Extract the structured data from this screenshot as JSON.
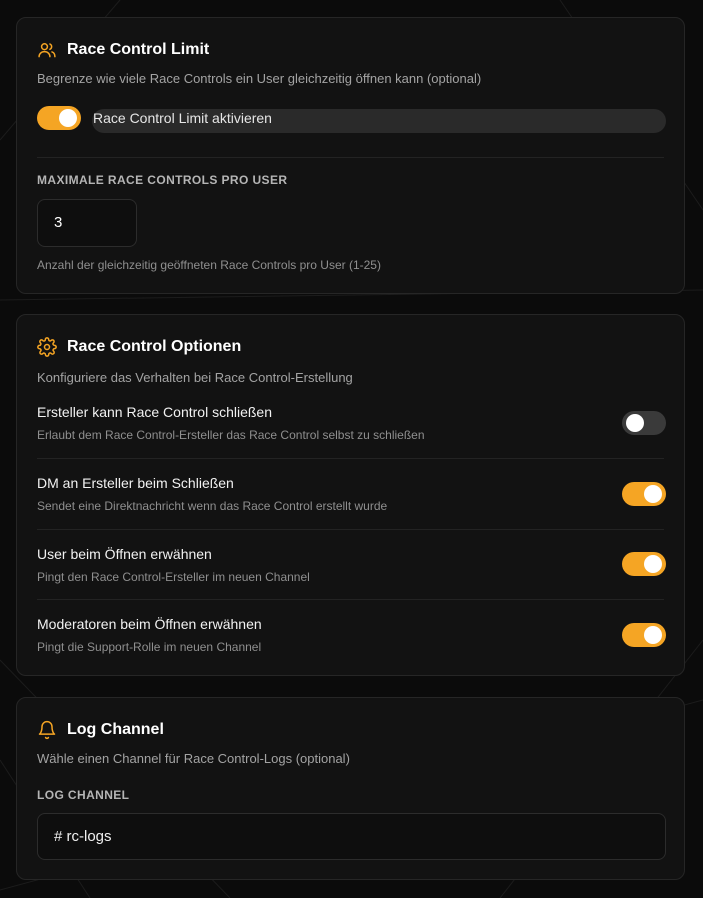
{
  "colors": {
    "accent": "#f5a524",
    "toggle_off": "#3a3a3a",
    "card_bg": "#121212",
    "page_bg": "#0b0b0b"
  },
  "limit_card": {
    "icon": "users-icon",
    "title": "Race Control Limit",
    "subtitle": "Begrenze wie viele Race Controls ein User gleichzeitig öffnen kann (optional)",
    "enable_toggle": {
      "label": "Race Control Limit aktivieren",
      "on": true
    },
    "max_label": "MAXIMALE RACE CONTROLS PRO USER",
    "max_value": "3",
    "hint": "Anzahl der gleichzeitig geöffneten Race Controls pro User (1-25)"
  },
  "options_card": {
    "icon": "gear-icon",
    "title": "Race Control Optionen",
    "subtitle": "Konfiguriere das Verhalten bei Race Control-Erstellung",
    "options": [
      {
        "title": "Ersteller kann Race Control schließen",
        "desc": "Erlaubt dem Race Control-Ersteller das Race Control selbst zu schließen",
        "on": false
      },
      {
        "title": "DM an Ersteller beim Schließen",
        "desc": "Sendet eine Direktnachricht wenn das Race Control erstellt wurde",
        "on": true
      },
      {
        "title": "User beim Öffnen erwähnen",
        "desc": "Pingt den Race Control-Ersteller im neuen Channel",
        "on": true
      },
      {
        "title": "Moderatoren beim Öffnen erwähnen",
        "desc": "Pingt die Support-Rolle im neuen Channel",
        "on": true
      }
    ]
  },
  "log_card": {
    "icon": "bell-icon",
    "title": "Log Channel",
    "subtitle": "Wähle einen Channel für Race Control-Logs (optional)",
    "field_label": "LOG CHANNEL",
    "channel_value": "# rc-logs"
  }
}
